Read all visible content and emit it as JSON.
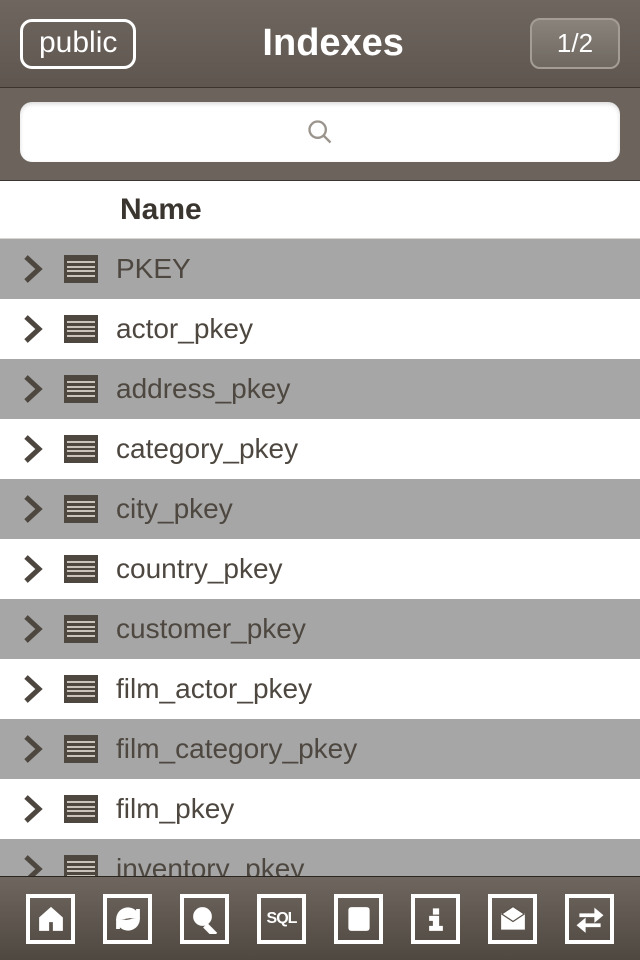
{
  "nav": {
    "back_label": "public",
    "title": "Indexes",
    "page_indicator": "1/2"
  },
  "search": {
    "placeholder": ""
  },
  "columns": {
    "name_label": "Name"
  },
  "rows": [
    {
      "name": "PKEY"
    },
    {
      "name": "actor_pkey"
    },
    {
      "name": "address_pkey"
    },
    {
      "name": "category_pkey"
    },
    {
      "name": "city_pkey"
    },
    {
      "name": "country_pkey"
    },
    {
      "name": "customer_pkey"
    },
    {
      "name": "film_actor_pkey"
    },
    {
      "name": "film_category_pkey"
    },
    {
      "name": "film_pkey"
    },
    {
      "name": "inventory_pkey"
    }
  ],
  "toolbar": {
    "home": "home",
    "refresh": "refresh",
    "search": "search",
    "sql": "SQL",
    "script": "script",
    "info": "info",
    "inbox": "inbox",
    "swap": "swap"
  }
}
